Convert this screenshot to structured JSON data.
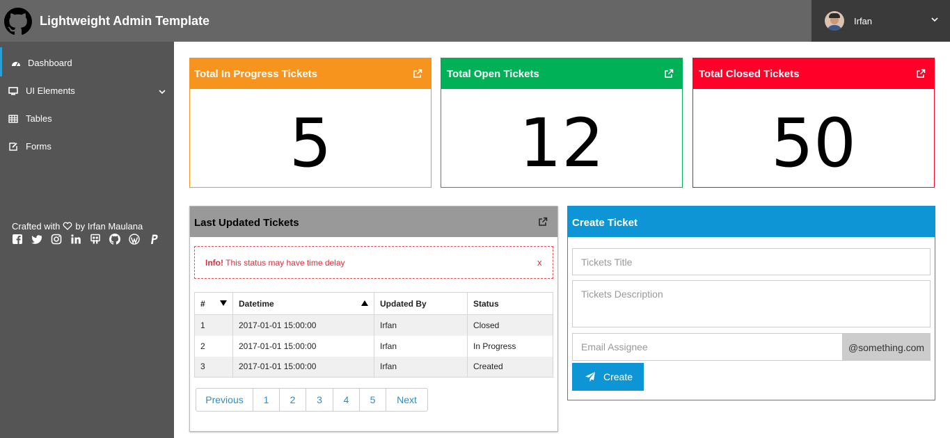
{
  "header": {
    "brand": "Lightweight Admin Template",
    "user_name": "Irfan"
  },
  "sidebar": {
    "items": [
      {
        "label": "Dashboard",
        "icon": "dashboard-icon",
        "active": true
      },
      {
        "label": "UI Elements",
        "icon": "desktop-icon",
        "has_submenu": true
      },
      {
        "label": "Tables",
        "icon": "table-icon"
      },
      {
        "label": "Forms",
        "icon": "edit-icon"
      }
    ],
    "crafted_prefix": "Crafted with",
    "crafted_suffix": "by Irfan Maulana",
    "socials": [
      "facebook-icon",
      "twitter-icon",
      "instagram-icon",
      "linkedin-icon",
      "slideshare-icon",
      "github-icon",
      "wordpress-icon",
      "paypal-icon"
    ]
  },
  "stats": [
    {
      "title": "Total In Progress Tickets",
      "value": "5",
      "color": "#f7941d"
    },
    {
      "title": "Total Open Tickets",
      "value": "12",
      "color": "#00b157"
    },
    {
      "title": "Total Closed Tickets",
      "value": "50",
      "color": "#ff0029"
    }
  ],
  "tickets_panel": {
    "title": "Last Updated Tickets",
    "header_color": "#999999",
    "alert": {
      "strong": "Info!",
      "text": " This status may have time delay",
      "close": "x"
    },
    "columns": [
      "#",
      "Datetime",
      "Updated By",
      "Status"
    ],
    "rows": [
      [
        "1",
        "2017-01-01 15:00:00",
        "Irfan",
        "Closed"
      ],
      [
        "2",
        "2017-01-01 15:00:00",
        "Irfan",
        "In Progress"
      ],
      [
        "3",
        "2017-01-01 15:00:00",
        "Irfan",
        "Created"
      ]
    ],
    "pagination": [
      "Previous",
      "1",
      "2",
      "3",
      "4",
      "5",
      "Next"
    ]
  },
  "create_panel": {
    "title": "Create Ticket",
    "header_color": "#0e95d6",
    "title_placeholder": "Tickets Title",
    "description_placeholder": "Tickets Description",
    "email_placeholder": "Email Assignee",
    "email_addon": "@something.com",
    "button_label": "Create"
  }
}
